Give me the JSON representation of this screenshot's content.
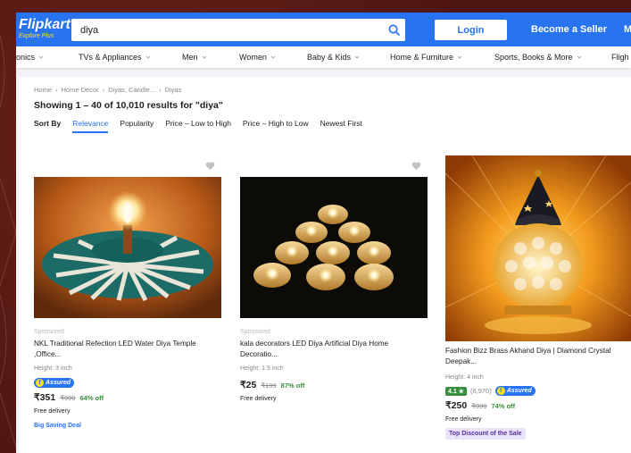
{
  "header": {
    "logo_main": "Flipkart",
    "logo_sub": "Explore Plus",
    "search_value": "diya",
    "login_label": "Login",
    "seller_label": "Become a Seller",
    "more_label": "M",
    "brand_color": "#2874f0"
  },
  "categories": [
    {
      "label": "onics"
    },
    {
      "label": "TVs & Appliances"
    },
    {
      "label": "Men"
    },
    {
      "label": "Women"
    },
    {
      "label": "Baby & Kids"
    },
    {
      "label": "Home & Furniture"
    },
    {
      "label": "Sports, Books & More"
    },
    {
      "label": "Fligh"
    }
  ],
  "breadcrumbs": [
    "Home",
    "Home Decor",
    "Diyas, Candle...",
    "Diyas"
  ],
  "results_title": "Showing 1 – 40 of 10,010 results for \"diya\"",
  "sort": {
    "label": "Sort By",
    "options": [
      "Relevance",
      "Popularity",
      "Price – Low to High",
      "Price – High to Low",
      "Newest First"
    ],
    "active": "Relevance"
  },
  "products": [
    {
      "sponsored": "Sponsored",
      "name_line1": "NKL Traditional Refection LED Water Diya Temple",
      "name_line2": ",Office...",
      "meta": "Height: 3 inch",
      "assured": "Assured",
      "price": "₹351",
      "mrp": "₹999",
      "off": "64% off",
      "delivery": "Free delivery",
      "deal": "Big Saving Deal"
    },
    {
      "sponsored": "Sponsored",
      "name_line1": "kala decorators LED Diya Artificial Diya Home",
      "name_line2": "Decoratio...",
      "meta": "Height: 1.5 inch",
      "price": "₹25",
      "mrp": "₹199",
      "off": "87% off",
      "delivery": "Free delivery"
    },
    {
      "name_line1": "Fashion Bizz Brass Akhand Diya | Diamond Crystal",
      "name_line2": "Deepak...",
      "meta": "Height: 4 inch",
      "rating": "4.1 ★",
      "rating_count": "(6,970)",
      "assured": "Assured",
      "price": "₹250",
      "mrp": "₹999",
      "off": "74% off",
      "delivery": "Free delivery",
      "badge": "Top Discount of the Sale"
    }
  ]
}
